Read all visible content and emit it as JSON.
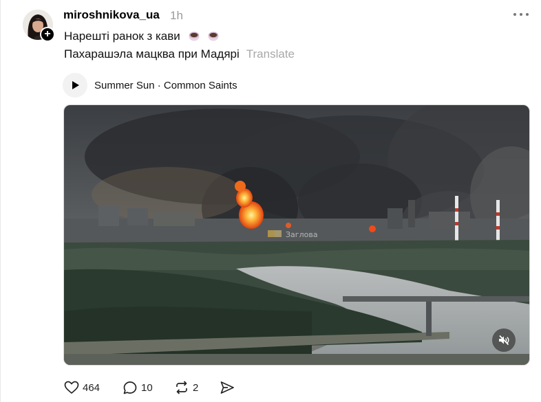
{
  "post": {
    "username": "miroshnikova_ua",
    "time": "1h",
    "text_line1": "Нарешті ранок з кави",
    "text_line2": "Пахарашэла мацква при Мадярі",
    "translate_label": "Translate",
    "music": {
      "label": "Summer Sun · Common Saints"
    },
    "media": {
      "watermark": "Заглова"
    },
    "actions": {
      "likes": "464",
      "replies": "10",
      "reposts": "2"
    }
  },
  "icons": {
    "more": "more-dots-icon",
    "play": "play-icon",
    "mute": "speaker-muted-icon",
    "like": "heart-icon",
    "reply": "comment-icon",
    "repost": "repost-icon",
    "share": "send-icon",
    "follow": "plus-icon",
    "emoji": "coffee-emoji-icon"
  }
}
